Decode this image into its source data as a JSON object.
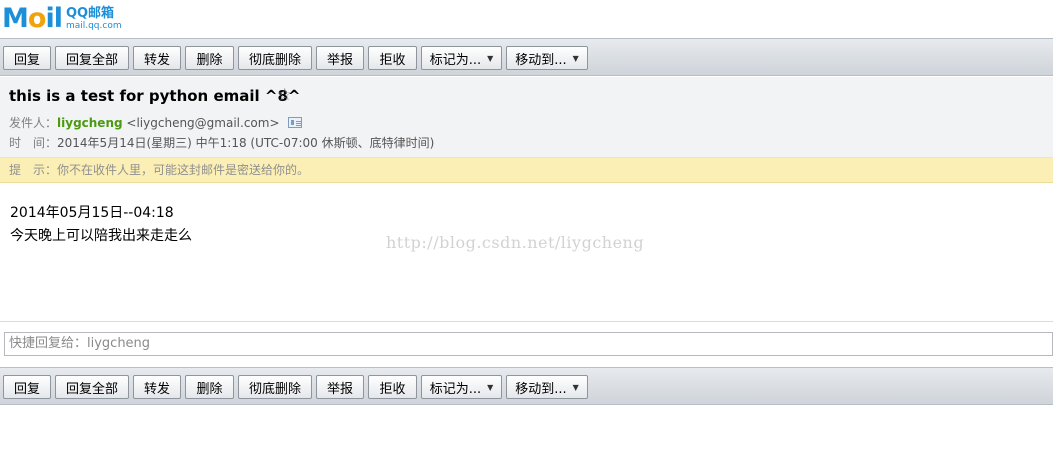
{
  "app": {
    "logo_mark_m": "M",
    "logo_mark_o": "o",
    "logo_mark_il": "il",
    "logo_title": "QQ邮箱",
    "logo_domain": "mail.qq.com"
  },
  "toolbar": {
    "reply": "回复",
    "reply_all": "回复全部",
    "forward": "转发",
    "delete": "删除",
    "delete_permanently": "彻底删除",
    "report": "举报",
    "reject": "拒收",
    "mark_as": "标记为...",
    "move_to": "移动到...",
    "caret": "▼"
  },
  "mail": {
    "subject": "this is a test for python email ^8^",
    "star": "☆",
    "from_label": "发件人：",
    "sender_name": "liygcheng",
    "sender_email": "<liygcheng@gmail.com>",
    "time_label": "时　间：",
    "time_value": "2014年5月14日(星期三) 中午1:18 (UTC-07:00 休斯顿、底特律时间)",
    "notice": "提　示：你不在收件人里，可能这封邮件是密送给你的。",
    "body_line_1": "2014年05月15日--04:18",
    "body_line_2": "今天晚上可以陪我出来走走么",
    "watermark": "http://blog.csdn.net/liygcheng"
  },
  "quick_reply": {
    "placeholder": "快捷回复给：liygcheng"
  }
}
